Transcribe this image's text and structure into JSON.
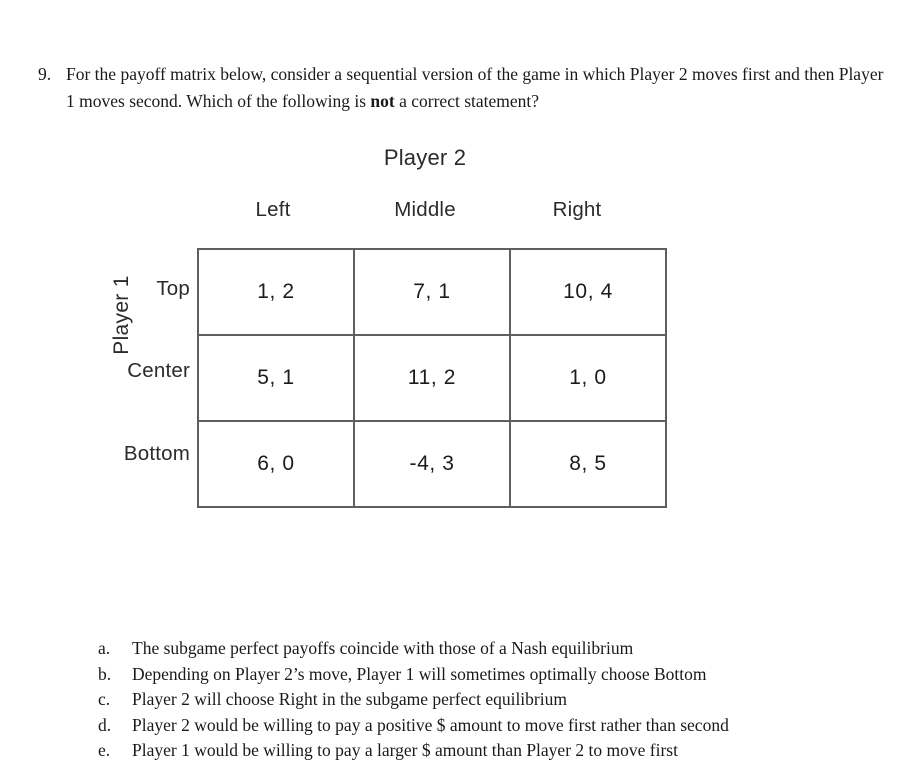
{
  "question": {
    "number": "9.",
    "text_before_bold": "For the payoff matrix below, consider a sequential version of the game in which Player 2 moves first and then Player 1 moves second. Which of the following is ",
    "bold_word": "not",
    "text_after_bold": " a correct statement?"
  },
  "matrix": {
    "column_group_label": "Player 2",
    "row_group_label": "Player 1",
    "column_headers": [
      "Left",
      "Middle",
      "Right"
    ],
    "row_headers": [
      "Top",
      "Center",
      "Bottom"
    ],
    "cells": [
      [
        "1, 2",
        "7, 1",
        "10, 4"
      ],
      [
        "5, 1",
        "11, 2",
        "1, 0"
      ],
      [
        "6, 0",
        "-4, 3",
        "8, 5"
      ]
    ],
    "border_color": "#5e5e5e"
  },
  "options": [
    {
      "letter": "a.",
      "text": "The subgame perfect payoffs coincide with those of a Nash equilibrium"
    },
    {
      "letter": "b.",
      "text": "Depending on Player 2’s move, Player 1 will sometimes optimally choose Bottom"
    },
    {
      "letter": "c.",
      "text": "Player 2 will choose Right in the subgame perfect equilibrium"
    },
    {
      "letter": "d.",
      "text": "Player 2 would be willing to pay a positive $ amount to move first rather than second"
    },
    {
      "letter": "e.",
      "text": "Player 1 would be willing to pay a larger $ amount than Player 2 to move first"
    }
  ]
}
